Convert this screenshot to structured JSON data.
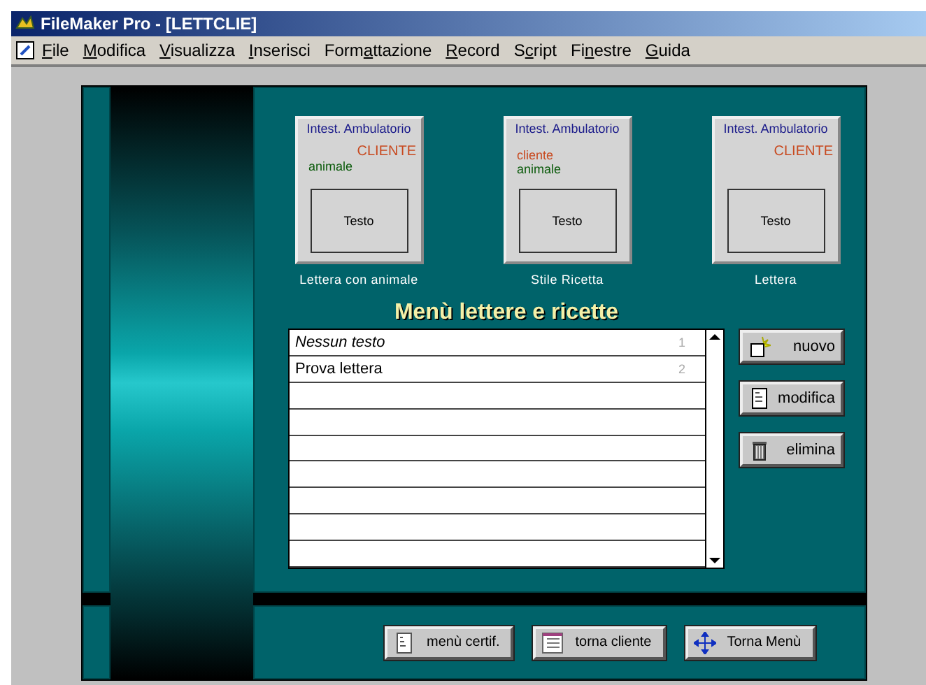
{
  "window": {
    "title": "FileMaker Pro - [LETTCLIE]"
  },
  "menu": [
    {
      "label": "File"
    },
    {
      "label": "Modifica"
    },
    {
      "label": "Visualizza"
    },
    {
      "label": "Inserisci"
    },
    {
      "label": "Formattazione"
    },
    {
      "label": "Record"
    },
    {
      "label": "Script"
    },
    {
      "label": "Finestre"
    },
    {
      "label": "Guida"
    }
  ],
  "templates": [
    {
      "lines": [
        {
          "kind": "header",
          "text": "Intest. Ambulatorio"
        },
        {
          "kind": "client",
          "text": "CLIENTE"
        },
        {
          "kind": "animal",
          "text": "animale"
        }
      ],
      "box": "Testo",
      "caption": "Lettera con animale"
    },
    {
      "lines": [
        {
          "kind": "header",
          "text": "Intest. Ambulatorio"
        },
        {
          "kind": "client_small",
          "text": "cliente"
        },
        {
          "kind": "animal",
          "text": "animale"
        }
      ],
      "box": "Testo",
      "caption": "Stile Ricetta"
    },
    {
      "lines": [
        {
          "kind": "header",
          "text": "Intest. Ambulatorio"
        },
        {
          "kind": "client",
          "text": "CLIENTE"
        }
      ],
      "box": "Testo",
      "caption": "Lettera"
    }
  ],
  "list_title": "Menù lettere e ricette",
  "list_rows": [
    {
      "text": "Nessun testo",
      "number": "1",
      "italic": true
    },
    {
      "text": "Prova lettera",
      "number": "2",
      "italic": false
    }
  ],
  "side_buttons": [
    {
      "kind": "new",
      "label": "nuovo"
    },
    {
      "kind": "edit",
      "label": "modifica"
    },
    {
      "kind": "delete",
      "label": "elimina"
    }
  ],
  "bottom_buttons": [
    {
      "kind": "doc",
      "label": "menù certif."
    },
    {
      "kind": "form",
      "label": "torna cliente"
    },
    {
      "kind": "arrows",
      "label": "Torna Menù"
    }
  ]
}
